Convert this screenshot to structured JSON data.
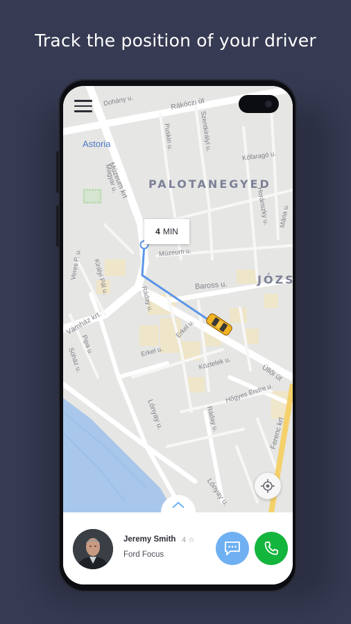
{
  "headline": "Track the position of your driver",
  "map": {
    "labels": {
      "dohany": "Dohány u.",
      "rakoczi": "Rákóczi út",
      "astoria": "Astoria",
      "muzeum_krt": "Múzeum krt",
      "palotanegyed": "PALOTANEGYED",
      "muzeum_u": "Múzeum u.",
      "baross": "Baross u.",
      "jozs": "JÓZS",
      "vamhaz": "Vámház krt.",
      "lonyay": "Lónyay u.",
      "lonyay2": "Lónyay u.",
      "ulloi": "Üllői út",
      "ferenc": "Ferenc krt",
      "kozepek": "Köztelek u.",
      "hogyes": "Hőgyes Endre u.",
      "rday": "Ráday u.",
      "rday2": "Ráday u.",
      "erkel": "Erkel u.",
      "erkel2": "Erkel u.",
      "pusztaszeri": "Puskin u.",
      "szentkiraly": "Szentkirályi u.",
      "magyar": "Magyar u.",
      "kofarago": "Kőfaragó u.",
      "horansky": "Horánszky u.",
      "maria": "Mária u.",
      "kiraly_pal": "Királyi Pál u.",
      "veres": "Veres P. u.",
      "pipa": "Pipa u.",
      "sohaz": "Sóház u."
    },
    "eta": {
      "value": "4",
      "unit": "MIN"
    }
  },
  "driver": {
    "name": "Jeremy Smith",
    "rating": "4 ☆",
    "car": "Ford Focus"
  },
  "colors": {
    "background": "#363a52",
    "route": "#5a95e8",
    "chat_button": "#6fb0f2",
    "call_button": "#14b53d",
    "taxi": "#f2b322"
  },
  "icons": {
    "menu": "hamburger-menu-icon",
    "locate": "crosshair-icon",
    "expand": "chevron-up-icon",
    "chat": "chat-bubble-icon",
    "call": "phone-icon",
    "taxi": "car-icon"
  }
}
